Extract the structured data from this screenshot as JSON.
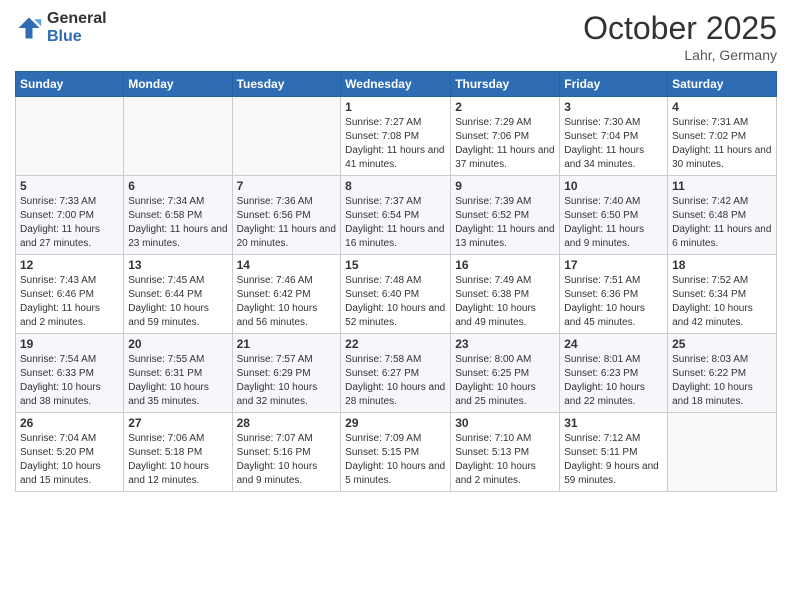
{
  "header": {
    "logo_general": "General",
    "logo_blue": "Blue",
    "month_year": "October 2025",
    "location": "Lahr, Germany"
  },
  "weekdays": [
    "Sunday",
    "Monday",
    "Tuesday",
    "Wednesday",
    "Thursday",
    "Friday",
    "Saturday"
  ],
  "weeks": [
    [
      {
        "day": "",
        "info": ""
      },
      {
        "day": "",
        "info": ""
      },
      {
        "day": "",
        "info": ""
      },
      {
        "day": "1",
        "info": "Sunrise: 7:27 AM\nSunset: 7:08 PM\nDaylight: 11 hours and 41 minutes."
      },
      {
        "day": "2",
        "info": "Sunrise: 7:29 AM\nSunset: 7:06 PM\nDaylight: 11 hours and 37 minutes."
      },
      {
        "day": "3",
        "info": "Sunrise: 7:30 AM\nSunset: 7:04 PM\nDaylight: 11 hours and 34 minutes."
      },
      {
        "day": "4",
        "info": "Sunrise: 7:31 AM\nSunset: 7:02 PM\nDaylight: 11 hours and 30 minutes."
      }
    ],
    [
      {
        "day": "5",
        "info": "Sunrise: 7:33 AM\nSunset: 7:00 PM\nDaylight: 11 hours and 27 minutes."
      },
      {
        "day": "6",
        "info": "Sunrise: 7:34 AM\nSunset: 6:58 PM\nDaylight: 11 hours and 23 minutes."
      },
      {
        "day": "7",
        "info": "Sunrise: 7:36 AM\nSunset: 6:56 PM\nDaylight: 11 hours and 20 minutes."
      },
      {
        "day": "8",
        "info": "Sunrise: 7:37 AM\nSunset: 6:54 PM\nDaylight: 11 hours and 16 minutes."
      },
      {
        "day": "9",
        "info": "Sunrise: 7:39 AM\nSunset: 6:52 PM\nDaylight: 11 hours and 13 minutes."
      },
      {
        "day": "10",
        "info": "Sunrise: 7:40 AM\nSunset: 6:50 PM\nDaylight: 11 hours and 9 minutes."
      },
      {
        "day": "11",
        "info": "Sunrise: 7:42 AM\nSunset: 6:48 PM\nDaylight: 11 hours and 6 minutes."
      }
    ],
    [
      {
        "day": "12",
        "info": "Sunrise: 7:43 AM\nSunset: 6:46 PM\nDaylight: 11 hours and 2 minutes."
      },
      {
        "day": "13",
        "info": "Sunrise: 7:45 AM\nSunset: 6:44 PM\nDaylight: 10 hours and 59 minutes."
      },
      {
        "day": "14",
        "info": "Sunrise: 7:46 AM\nSunset: 6:42 PM\nDaylight: 10 hours and 56 minutes."
      },
      {
        "day": "15",
        "info": "Sunrise: 7:48 AM\nSunset: 6:40 PM\nDaylight: 10 hours and 52 minutes."
      },
      {
        "day": "16",
        "info": "Sunrise: 7:49 AM\nSunset: 6:38 PM\nDaylight: 10 hours and 49 minutes."
      },
      {
        "day": "17",
        "info": "Sunrise: 7:51 AM\nSunset: 6:36 PM\nDaylight: 10 hours and 45 minutes."
      },
      {
        "day": "18",
        "info": "Sunrise: 7:52 AM\nSunset: 6:34 PM\nDaylight: 10 hours and 42 minutes."
      }
    ],
    [
      {
        "day": "19",
        "info": "Sunrise: 7:54 AM\nSunset: 6:33 PM\nDaylight: 10 hours and 38 minutes."
      },
      {
        "day": "20",
        "info": "Sunrise: 7:55 AM\nSunset: 6:31 PM\nDaylight: 10 hours and 35 minutes."
      },
      {
        "day": "21",
        "info": "Sunrise: 7:57 AM\nSunset: 6:29 PM\nDaylight: 10 hours and 32 minutes."
      },
      {
        "day": "22",
        "info": "Sunrise: 7:58 AM\nSunset: 6:27 PM\nDaylight: 10 hours and 28 minutes."
      },
      {
        "day": "23",
        "info": "Sunrise: 8:00 AM\nSunset: 6:25 PM\nDaylight: 10 hours and 25 minutes."
      },
      {
        "day": "24",
        "info": "Sunrise: 8:01 AM\nSunset: 6:23 PM\nDaylight: 10 hours and 22 minutes."
      },
      {
        "day": "25",
        "info": "Sunrise: 8:03 AM\nSunset: 6:22 PM\nDaylight: 10 hours and 18 minutes."
      }
    ],
    [
      {
        "day": "26",
        "info": "Sunrise: 7:04 AM\nSunset: 5:20 PM\nDaylight: 10 hours and 15 minutes."
      },
      {
        "day": "27",
        "info": "Sunrise: 7:06 AM\nSunset: 5:18 PM\nDaylight: 10 hours and 12 minutes."
      },
      {
        "day": "28",
        "info": "Sunrise: 7:07 AM\nSunset: 5:16 PM\nDaylight: 10 hours and 9 minutes."
      },
      {
        "day": "29",
        "info": "Sunrise: 7:09 AM\nSunset: 5:15 PM\nDaylight: 10 hours and 5 minutes."
      },
      {
        "day": "30",
        "info": "Sunrise: 7:10 AM\nSunset: 5:13 PM\nDaylight: 10 hours and 2 minutes."
      },
      {
        "day": "31",
        "info": "Sunrise: 7:12 AM\nSunset: 5:11 PM\nDaylight: 9 hours and 59 minutes."
      },
      {
        "day": "",
        "info": ""
      }
    ]
  ]
}
